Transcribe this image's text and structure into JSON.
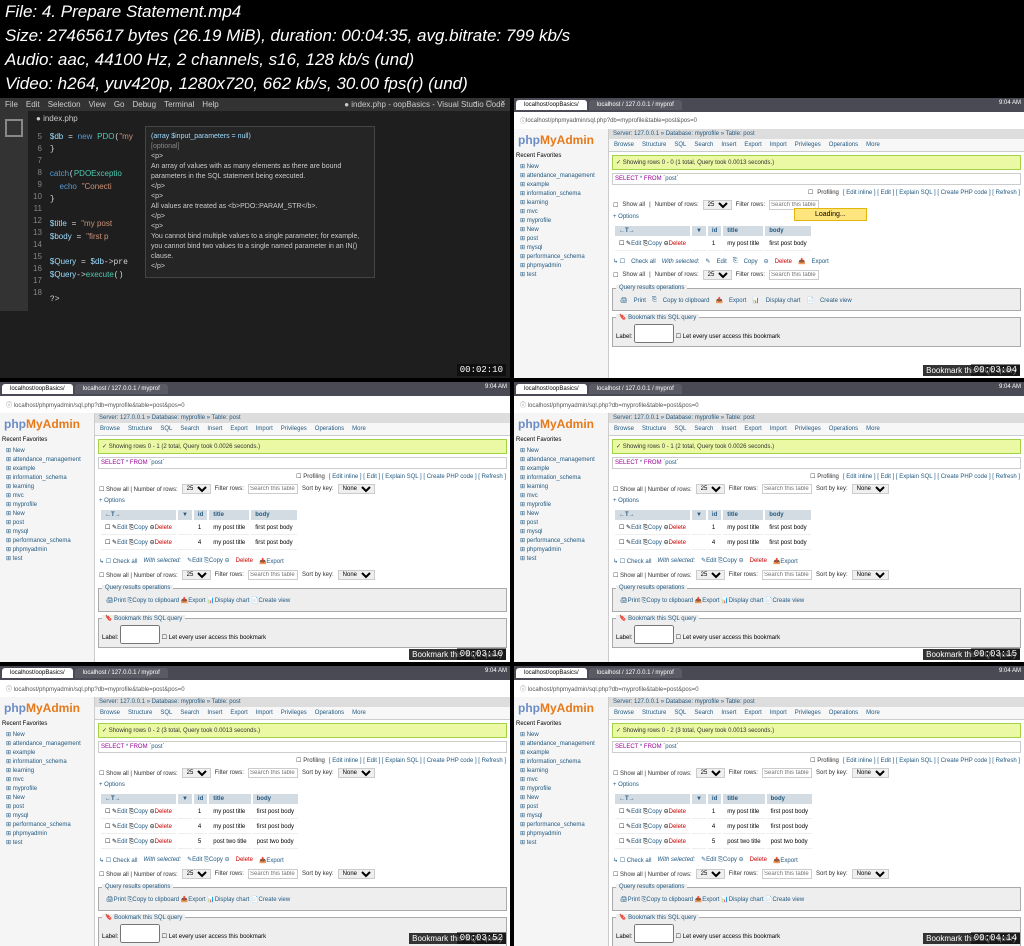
{
  "file_info": {
    "line1": "File: 4. Prepare Statement.mp4",
    "line2": "Size: 27465617 bytes (26.19 MiB), duration: 00:04:35, avg.bitrate: 799 kb/s",
    "line3": "Audio: aac, 44100 Hz, 2 channels, s16, 128 kb/s (und)",
    "line4": "Video: h264, yuv420p, 1280x720, 662 kb/s, 30.00 fps(r) (und)"
  },
  "vscode": {
    "menu": [
      "File",
      "Edit",
      "Selection",
      "View",
      "Go",
      "Debug",
      "Terminal",
      "Help"
    ],
    "title": "index.php - oopBasics - Visual Studio Code",
    "tab": "index.php",
    "tooltip_sig": "(array $input_parameters = null)",
    "tooltip_opt": "[optional]",
    "tooltip_l1": "An array of values with as many elements as there are bound parameters in the SQL statement being executed.",
    "tooltip_l2": "All values are treated as <b>PDO::PARAM_STR</b>.",
    "tooltip_l3": "You cannot bind multiple values to a single parameter; for example, you cannot bind two values to a single named parameter in an IN() clause.",
    "code_lines": [
      "5",
      "6",
      "7",
      "8",
      "9",
      "10",
      "11",
      "12",
      "13",
      "14",
      "15",
      "16",
      "17",
      "18"
    ]
  },
  "browser": {
    "tab1": "localhost/oopBasics/",
    "tab2": "localhost / 127.0.0.1 / myprof",
    "url": "localhost/phpmyadmin/sql.php?db=myprofile&table=post&pos=0"
  },
  "pma": {
    "logo1": "php",
    "logo2": "MyAdmin",
    "recent": "Recent",
    "favorites": "Favorites",
    "tree": [
      "New",
      "attendance_management",
      "example",
      "information_schema",
      "learning",
      "mvc",
      "myprofile",
      "New",
      "post",
      "mysql",
      "performance_schema",
      "phpmyadmin",
      "test"
    ],
    "crumb": "Server: 127.0.0.1 » Database: myprofile » Table: post",
    "tabs": [
      "Browse",
      "Structure",
      "SQL",
      "Search",
      "Insert",
      "Export",
      "Import",
      "Privileges",
      "Operations",
      "More"
    ],
    "success1": "Showing rows 0 - 0 (1 total, Query took 0.0013 seconds.)",
    "success2": "Showing rows 0 - 1 (2 total, Query took 0.0026 seconds.)",
    "success3": "Showing rows 0 - 2 (3 total, Query took 0.0013 seconds.)",
    "sql": "SELECT * FROM `post`",
    "profiling": "Profiling",
    "links": "[ Edit inline ] [ Edit ] [ Explain SQL ] [ Create PHP code ] [ Refresh ]",
    "showall": "Show all",
    "numrows": "Number of rows:",
    "filterrows": "Filter rows:",
    "searchplace": "Search this table",
    "sortby": "Sort by key:",
    "none": "None",
    "options": "+ Options",
    "loading": "Loading...",
    "cols": [
      "",
      "id",
      "title",
      "body"
    ],
    "row1": [
      "Edit",
      "Copy",
      "Delete",
      "1",
      "my post title",
      "first post body"
    ],
    "row2": [
      "Edit",
      "Copy",
      "Delete",
      "4",
      "my post title",
      "first post body"
    ],
    "row3": [
      "Edit",
      "Copy",
      "Delete",
      "5",
      "post two title",
      "post two body"
    ],
    "checkall": "Check all",
    "withsel": "With selected:",
    "actions": [
      "Edit",
      "Copy",
      "Delete",
      "Export"
    ],
    "qro": "Query results operations",
    "qro_actions": [
      "Print",
      "Copy to clipboard",
      "Export",
      "Display chart",
      "Create view"
    ],
    "bookmark": "Bookmark this SQL query",
    "label": "Label:",
    "letuser": "Let every user access this bookmark",
    "bmkbtn": "Bookmark this SQL query"
  },
  "timestamps": [
    "00:02:10",
    "00:03:04",
    "00:03:10",
    "00:03:15",
    "00:03:52",
    "00:04:14"
  ]
}
